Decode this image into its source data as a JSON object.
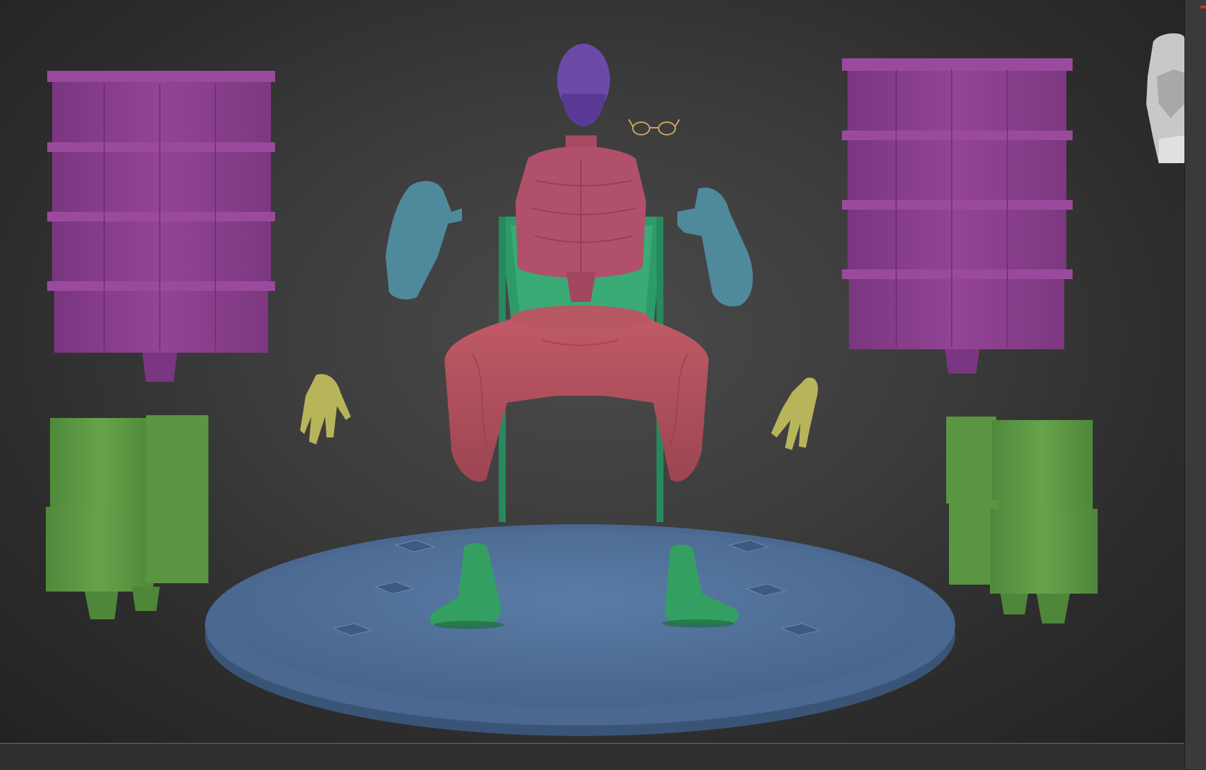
{
  "app": {
    "viewport_background": "#3c3c3c",
    "navigation_cube_icon": "head-gizmo-icon"
  },
  "colors": {
    "drawers": "#8c3f8e",
    "drawers_shade": "#6a2d6c",
    "boxes": "#5f9a45",
    "boxes_shade": "#4a7d36",
    "head": "#6c4aa8",
    "torso": "#b0506a",
    "sleeves": "#4f8a9c",
    "chair": "#2e9a6a",
    "pants": "#b25260",
    "hands": "#b8b45a",
    "boots": "#33a062",
    "base": "#4e6e96",
    "base_rim": "#3e5a7e",
    "glasses": "#c9a95a"
  }
}
